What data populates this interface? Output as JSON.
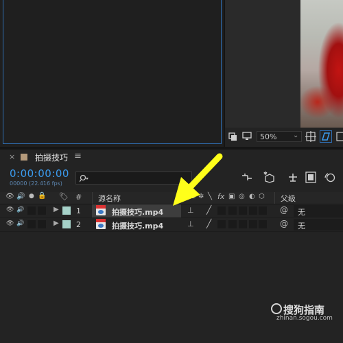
{
  "composition_panel": {
    "zoom": "50%"
  },
  "timeline": {
    "tab_title": "拍摄技巧",
    "timecode": "0:00:00:00",
    "fps_text": "00000 (22.416 fps)",
    "search_placeholder": "",
    "headers": {
      "number": "#",
      "source_name": "源名称",
      "parent": "父级"
    },
    "layers": [
      {
        "number": "1",
        "name": "拍摄技巧.mp4",
        "parent": "无",
        "selected": true
      },
      {
        "number": "2",
        "name": "拍摄技巧.mp4",
        "parent": "无",
        "selected": false
      }
    ]
  },
  "annotation": {
    "arrow_color": "#ffff1a"
  },
  "watermark": {
    "brand": "搜狗指南",
    "url": "zhinan.sogou.com"
  },
  "colors": {
    "accent_blue": "#3b9cf0",
    "label_swatch": "#a6d2c9"
  }
}
